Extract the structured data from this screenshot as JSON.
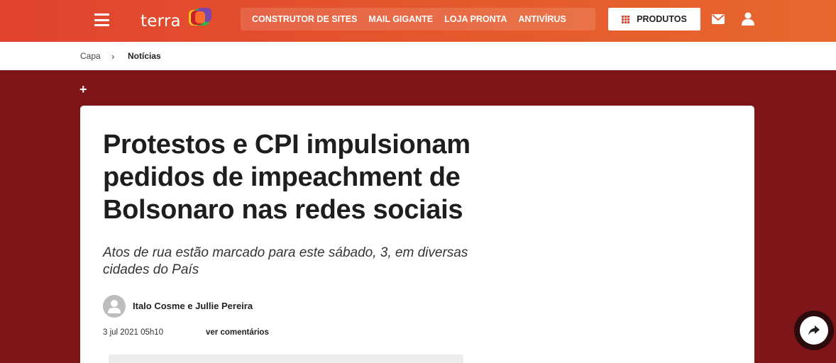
{
  "header": {
    "logo_text": "terra",
    "promo_links": [
      "CONSTRUTOR DE SITES",
      "MAIL GIGANTE",
      "LOJA PRONTA",
      "ANTIVÍRUS"
    ],
    "produtos_label": "PRODUTOS",
    "icons": [
      "menu-icon",
      "grid-icon",
      "mail-icon",
      "user-icon"
    ]
  },
  "breadcrumb": {
    "home": "Capa",
    "separator": "›",
    "current": "Notícias"
  },
  "plus_label": "+",
  "article": {
    "headline": "Protestos e CPI impulsionam pedidos de impeachment de Bolsonaro nas redes sociais",
    "subheadline": "Atos de rua estão marcado para este sábado, 3, em diversas cidades do País",
    "authors": "Italo Cosme e Jullie Pereira",
    "date": "3 jul 2021 05h10",
    "comments_link": "ver comentários"
  },
  "colors": {
    "header_orange": "#e0432e",
    "page_background": "#7d1519",
    "card_background": "#ffffff"
  },
  "share_icon": "share-icon"
}
